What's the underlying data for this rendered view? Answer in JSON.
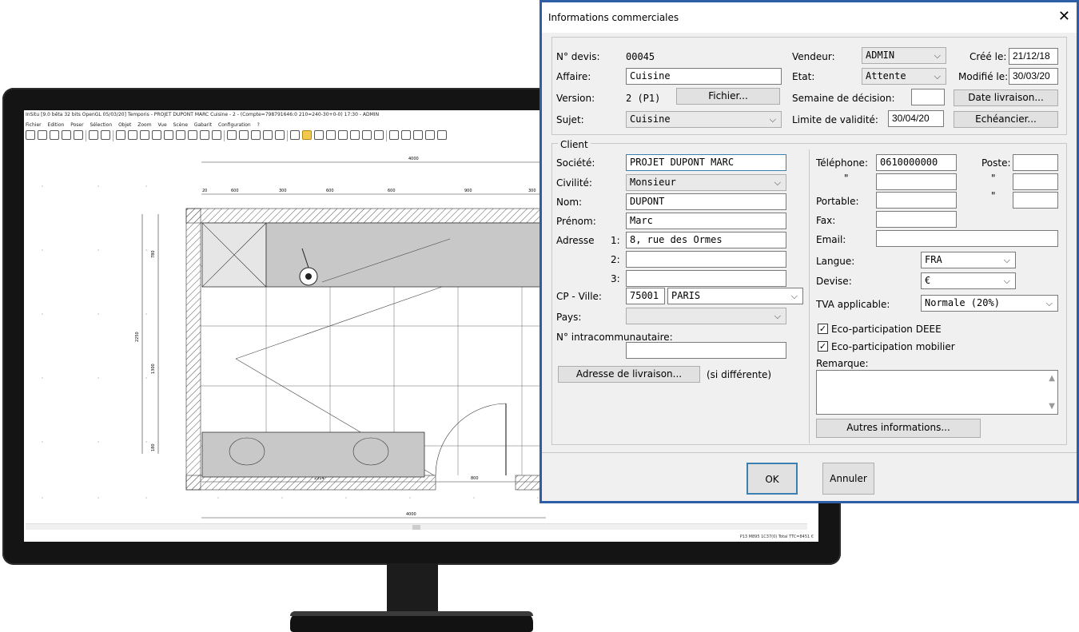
{
  "cad": {
    "title": "InSitu [9.0 bêta 32 bits OpenGL 05/03/20] Temporis - PROJET DUPONT MARC Cuisine - 2 - (Compte=798791646:0 210=240-30+0-0) 17:30 - ADMIN",
    "menu": [
      "Fichier",
      "Edition",
      "Poser",
      "Sélection",
      "Objet",
      "Zoom",
      "Vue",
      "Scène",
      "Gabarit",
      "Configuration",
      "?"
    ],
    "dimensions": {
      "top_total": "4000",
      "top_segments": [
        "20",
        "600",
        "300",
        "600",
        "600",
        "900",
        "300"
      ],
      "bottom_segments": [
        "2214",
        "800"
      ],
      "bottom_total": "4000",
      "left_total": "2250",
      "left_segments": [
        "780",
        "1300",
        "180"
      ]
    },
    "status": "P13 M895 1C37(0) Total TTC=8451 €"
  },
  "dialog": {
    "title": "Informations commerciales",
    "close_glyph": "✕",
    "devis": {
      "num_label": "N° devis:",
      "num_value": "00045",
      "affaire_label": "Affaire:",
      "affaire_value": "Cuisine",
      "version_label": "Version:",
      "version_value": "2 (P1)",
      "fichier_button": "Fichier...",
      "sujet_label": "Sujet:",
      "sujet_value": "Cuisine",
      "vendeur_label": "Vendeur:",
      "vendeur_value": "ADMIN",
      "etat_label": "Etat:",
      "etat_value": "Attente",
      "semaine_label": "Semaine de décision:",
      "semaine_value": "",
      "limite_label": "Limite de validité:",
      "limite_value": "30/04/20",
      "cree_label": "Créé le:",
      "cree_value": "21/12/18",
      "modifie_label": "Modifié le:",
      "modifie_value": "30/03/20",
      "date_livraison_button": "Date livraison...",
      "echeancier_button": "Echéancier..."
    },
    "client": {
      "group_label": "Client",
      "societe_label": "Société:",
      "societe_value": "PROJET DUPONT MARC",
      "civilite_label": "Civilité:",
      "civilite_value": "Monsieur",
      "nom_label": "Nom:",
      "nom_value": "DUPONT",
      "prenom_label": "Prénom:",
      "prenom_value": "Marc",
      "adresse_label": "Adresse",
      "adresse1_num": "1:",
      "adresse1_value": "8, rue des Ormes",
      "adresse2_num": "2:",
      "adresse2_value": "",
      "adresse3_num": "3:",
      "adresse3_value": "",
      "cp_label": "CP - Ville:",
      "cp_value": "75001",
      "ville_value": "PARIS",
      "pays_label": "Pays:",
      "pays_value": "",
      "intra_label": "N° intracommunautaire:",
      "intra_value": "",
      "livraison_button": "Adresse de livraison...",
      "livraison_note": "(si différente)",
      "telephone_label": "Téléphone:",
      "telephone_value": "0610000000",
      "poste_label": "Poste:",
      "poste_value": "",
      "ditto": "\"",
      "portable_label": "Portable:",
      "portable_value": "",
      "fax_label": "Fax:",
      "fax_value": "",
      "email_label": "Email:",
      "email_value": "",
      "langue_label": "Langue:",
      "langue_value": "FRA",
      "devise_label": "Devise:",
      "devise_value": "€",
      "tva_label": "TVA applicable:",
      "tva_value": "Normale (20%)",
      "eco_deee_label": "Eco-participation DEEE",
      "eco_deee_checked": true,
      "eco_mobilier_label": "Eco-participation mobilier",
      "eco_mobilier_checked": true,
      "remarque_label": "Remarque:",
      "remarque_value": "",
      "autres_button": "Autres informations..."
    },
    "ok_button": "OK",
    "annuler_button": "Annuler",
    "check_glyph": "✓",
    "arrow_glyph": "⌵"
  }
}
